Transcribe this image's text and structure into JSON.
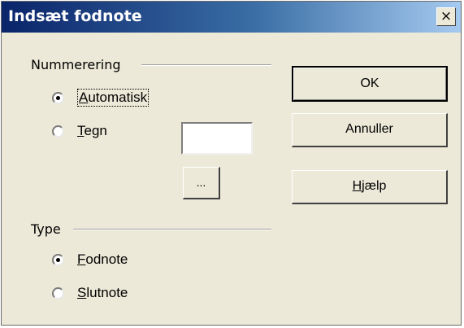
{
  "window": {
    "title": "Indsæt fodnote",
    "close_glyph": "×"
  },
  "numbering_group": {
    "label": "Nummerering",
    "options": [
      {
        "label": "Automatisk",
        "mnemonic": "A",
        "rest": "utomatisk",
        "checked": true
      },
      {
        "label": "Tegn",
        "mnemonic": "T",
        "rest": "egn",
        "checked": false
      }
    ],
    "character_value": "",
    "browse_label": "..."
  },
  "type_group": {
    "label": "Type",
    "options": [
      {
        "label": "Fodnote",
        "mnemonic": "F",
        "rest": "odnote",
        "checked": true
      },
      {
        "label": "Slutnote",
        "mnemonic": "S",
        "rest": "lutnote",
        "checked": false
      }
    ]
  },
  "buttons": {
    "ok": "OK",
    "cancel": "Annuller",
    "help_mnemonic": "H",
    "help_rest": "jælp"
  }
}
